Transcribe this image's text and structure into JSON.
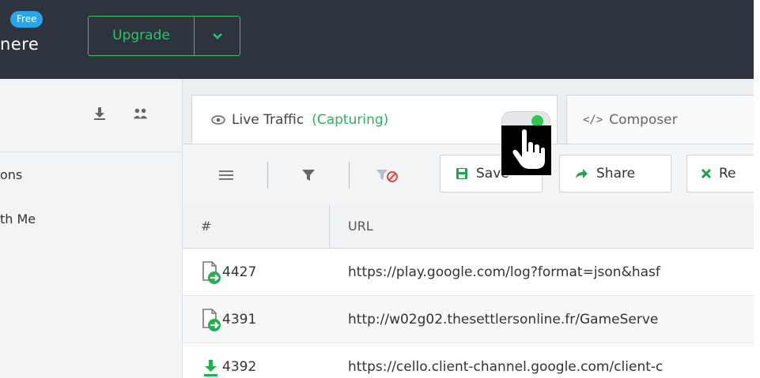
{
  "header": {
    "free_badge": "Free",
    "app_name_fragment": "nere",
    "upgrade_label": "Upgrade",
    "upgrade_menu_icon": "chevron-down-icon"
  },
  "sidebar": {
    "header_icons": [
      "download-icon",
      "users-icon"
    ],
    "items": [
      {
        "label": "ons"
      },
      {
        "label": "th Me"
      }
    ]
  },
  "tabs": [
    {
      "label": "Live Traffic",
      "status": "(Capturing)",
      "icon": "eye-icon",
      "active": true,
      "capture_toggle_on": true
    },
    {
      "label": "Composer",
      "icon": "code-icon",
      "active": false
    }
  ],
  "toolbar": {
    "icons": [
      "menu-icon",
      "filter-icon",
      "clear-filter-icon"
    ],
    "buttons": [
      {
        "label": "Save",
        "icon": "save-icon"
      },
      {
        "label": "Share",
        "icon": "share-icon"
      },
      {
        "label": "Re",
        "icon": "remove-icon"
      }
    ]
  },
  "table": {
    "columns": [
      "#",
      "URL"
    ],
    "rows": [
      {
        "num": "4427",
        "url": "https://play.google.com/log?format=json&hasf",
        "icon": "request-arrow-icon"
      },
      {
        "num": "4391",
        "url": "http://w02g02.thesettlersonline.fr/GameServe",
        "icon": "request-arrow-icon"
      },
      {
        "num": "4392",
        "url": "https://cello.client-channel.google.com/client-c",
        "icon": "download-icon"
      }
    ]
  },
  "colors": {
    "topbar": "#2d343e",
    "accent_green": "#29c46d",
    "badge_blue": "#29a6ea"
  }
}
